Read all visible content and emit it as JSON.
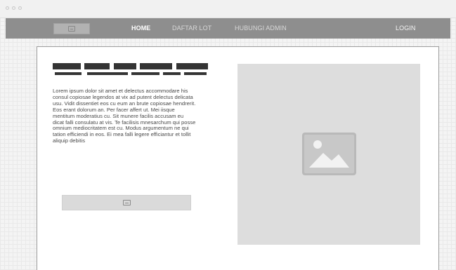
{
  "window": {
    "controls": [
      "close-dot",
      "minimize-dot",
      "maximize-dot"
    ]
  },
  "nav": {
    "logo_icon": "logo-image-icon",
    "items": [
      {
        "label": "HOME",
        "active": true
      },
      {
        "label": "DAFTAR LOT",
        "active": false
      },
      {
        "label": "HUBUNGI ADMIN",
        "active": false
      }
    ],
    "login_label": "LOGIN"
  },
  "hero": {
    "title_placeholder": "redacted-heading-bars",
    "body": "Lorem ipsum dolor sit amet et delectus accommodare his consul copiosae legendos at vix ad putent delectus delicata usu. Vidit dissentiet eos cu eum an brute copiosae hendrerit. Eos erant dolorum an. Per facer affert ut. Mei iisque mentitum moderatius cu. Sit munere facilis accusam eu dicat falli consulatu at vis. Te facilisis mnesarchum qui posse omnium mediocritatem est cu. Modus argumentum ne qui tation efficiendi in eos. Ei mea falli legere efficiantur et tollit aliquip debitis",
    "button_icon": "image-icon",
    "image_icon": "landscape-image-icon"
  },
  "colors": {
    "navbar": "#8e8e8e",
    "nav_active": "#ffffff",
    "heading_bars": "#343434",
    "image_bg": "#dddddd",
    "image_icon": "#b7b7b7"
  }
}
